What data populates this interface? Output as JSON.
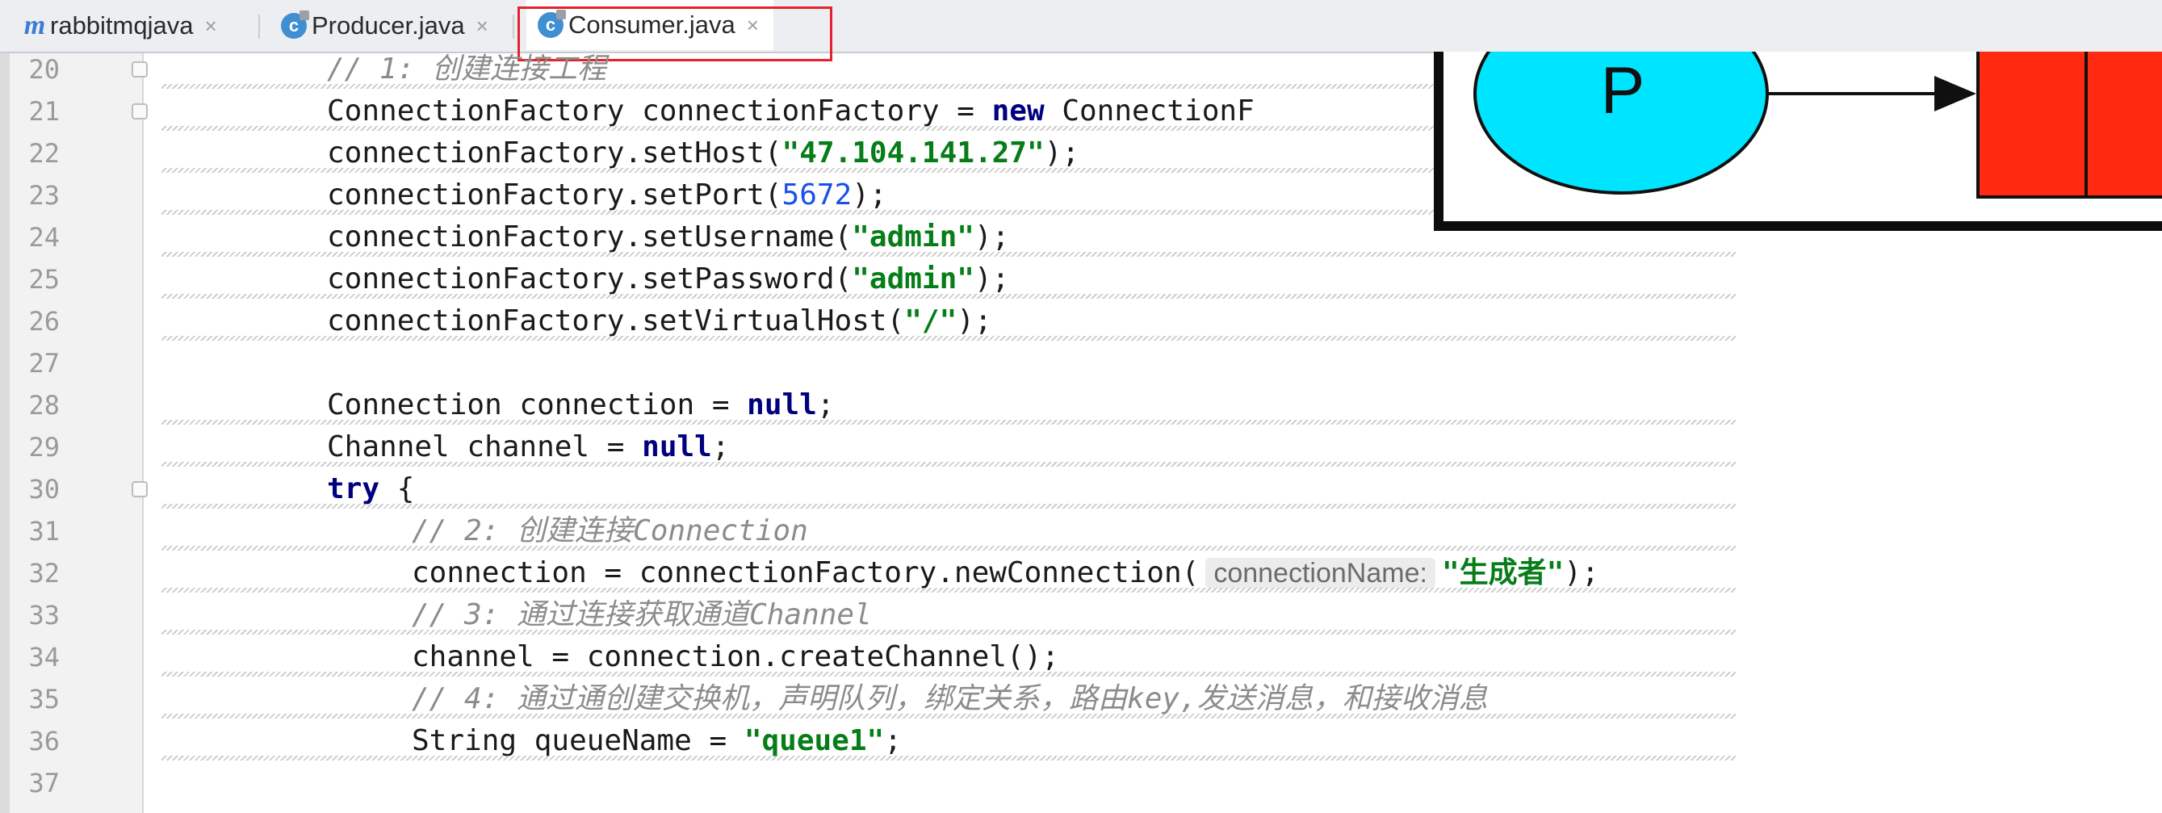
{
  "tabs": [
    {
      "label": "rabbitmqjava",
      "icon": "maven-module-icon",
      "active": false
    },
    {
      "label": "Producer.java",
      "icon": "java-class-icon",
      "active": false
    },
    {
      "label": "Consumer.java",
      "icon": "java-class-icon",
      "active": true
    }
  ],
  "tab_close_glyph": "×",
  "editor": {
    "lines": [
      {
        "n": "20",
        "tokens": [
          [
            "cmt",
            "// 1: 创建连接工程"
          ]
        ]
      },
      {
        "n": "21",
        "tokens": [
          [
            "p",
            "ConnectionFactory connectionFactory = "
          ],
          [
            "kw",
            "new"
          ],
          [
            "p",
            " ConnectionF"
          ]
        ]
      },
      {
        "n": "22",
        "tokens": [
          [
            "p",
            "connectionFactory.setHost("
          ],
          [
            "str",
            "\"47.104.141.27\""
          ],
          [
            "p",
            ");"
          ]
        ]
      },
      {
        "n": "23",
        "tokens": [
          [
            "p",
            "connectionFactory.setPort("
          ],
          [
            "num",
            "5672"
          ],
          [
            "p",
            ");"
          ]
        ]
      },
      {
        "n": "24",
        "tokens": [
          [
            "p",
            "connectionFactory.setUsername("
          ],
          [
            "str",
            "\"admin\""
          ],
          [
            "p",
            ");"
          ]
        ]
      },
      {
        "n": "25",
        "tokens": [
          [
            "p",
            "connectionFactory.setPassword("
          ],
          [
            "str",
            "\"admin\""
          ],
          [
            "p",
            ");"
          ]
        ]
      },
      {
        "n": "26",
        "tokens": [
          [
            "p",
            "connectionFactory.setVirtualHost("
          ],
          [
            "str",
            "\"/\""
          ],
          [
            "p",
            ");"
          ]
        ]
      },
      {
        "n": "27",
        "tokens": []
      },
      {
        "n": "28",
        "tokens": [
          [
            "p",
            "Connection connection = "
          ],
          [
            "kw",
            "null"
          ],
          [
            "p",
            ";"
          ]
        ]
      },
      {
        "n": "29",
        "tokens": [
          [
            "p",
            "Channel channel = "
          ],
          [
            "kw",
            "null"
          ],
          [
            "p",
            ";"
          ]
        ]
      },
      {
        "n": "30",
        "tokens": [
          [
            "kw",
            "try"
          ],
          [
            "p",
            " {"
          ]
        ]
      },
      {
        "n": "31",
        "tokens": [
          [
            "cmt",
            "// 2: 创建连接Connection"
          ]
        ]
      },
      {
        "n": "32",
        "tokens": [
          [
            "p",
            "connection = connectionFactory.newConnection("
          ],
          [
            "hint",
            "connectionName:"
          ],
          [
            "str",
            "\"生成者\""
          ],
          [
            "p",
            ");"
          ]
        ]
      },
      {
        "n": "33",
        "tokens": [
          [
            "cmt",
            "// 3: 通过连接获取通道Channel"
          ]
        ]
      },
      {
        "n": "34",
        "tokens": [
          [
            "p",
            "channel = connection.createChannel();"
          ]
        ]
      },
      {
        "n": "35",
        "tokens": [
          [
            "cmt",
            "// 4: 通过通创建交换机，声明队列，绑定关系，路由key,发送消息，和接收消息"
          ]
        ]
      },
      {
        "n": "36",
        "tokens": [
          [
            "p",
            "String queueName = "
          ],
          [
            "str",
            "\"queue1\""
          ],
          [
            "p",
            ";"
          ]
        ]
      },
      {
        "n": "37",
        "tokens": []
      }
    ]
  },
  "diagram": {
    "producer_label": "P",
    "colors": {
      "producer": "#00e5ff",
      "queue": "#ff2a10",
      "outline": "#101010"
    }
  },
  "colors": {
    "keyword": "#000080",
    "string": "#067d17",
    "number": "#1750eb",
    "comment": "#8c8c8c",
    "highlight": "#e5232b"
  }
}
